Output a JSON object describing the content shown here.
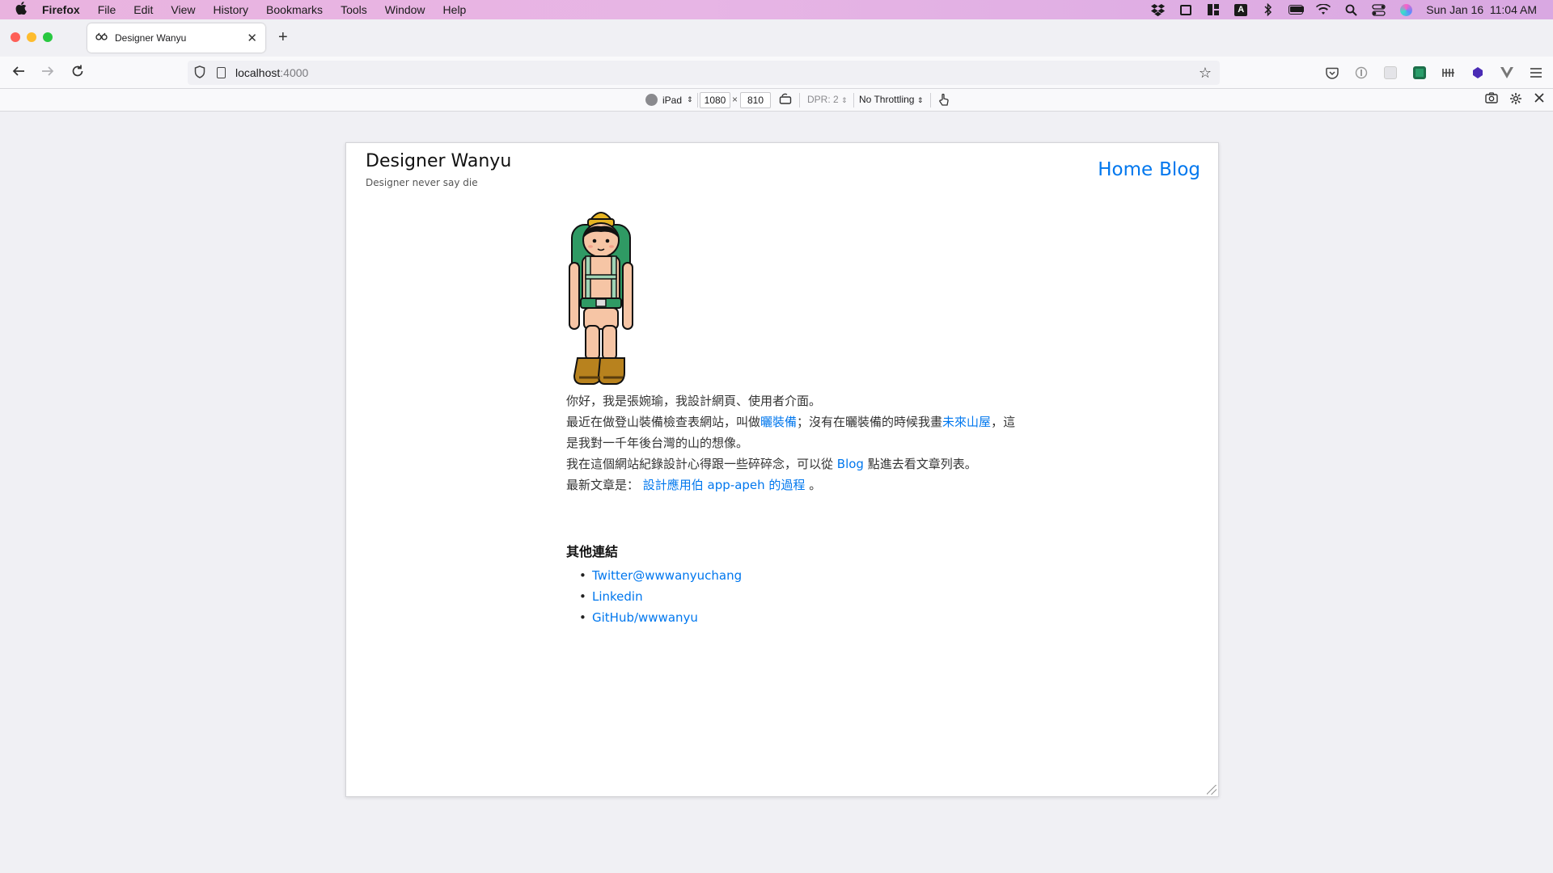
{
  "menubar": {
    "app_name": "Firefox",
    "items": [
      "File",
      "Edit",
      "View",
      "History",
      "Bookmarks",
      "Tools",
      "Window",
      "Help"
    ],
    "clock": "Sun Jan 16  11:04 AM"
  },
  "browser": {
    "tab_title": "Designer Wanyu",
    "url_host": "localhost",
    "url_port": ":4000"
  },
  "rdm": {
    "device": "iPad",
    "width": "1080",
    "height": "810",
    "times": "×",
    "dpr": "DPR: 2",
    "throttling": "No Throttling"
  },
  "site": {
    "title": "Designer Wanyu",
    "tagline": "Designer never say die",
    "nav": [
      "Home",
      "Blog"
    ],
    "intro": {
      "line1": "你好，我是張婉瑜，我設計網頁、使用者介面。",
      "line2_pre": "最近在做登山裝備檢查表網站，叫做",
      "line2_link1": "曬裝備",
      "line2_mid": "；沒有在曬裝備的時候我畫",
      "line2_link2": "未來山屋",
      "line2_post": "，這是我對一千年後台灣的山的想像。",
      "line3_pre": "我在這個網站紀錄設計心得跟一些碎碎念，可以從 ",
      "line3_link": "Blog",
      "line3_post": " 點進去看文章列表。",
      "line4_pre": "最新文章是： ",
      "line4_link": "設計應用伯 app-apeh 的過程",
      "line4_post": " 。"
    },
    "other_links_heading": "其他連結",
    "other_links": [
      "Twitter@wwwanyuchang",
      "Linkedin",
      "GitHub/wwwanyu"
    ]
  },
  "colors": {
    "link": "#0077ee",
    "menubar": "#e7b5e5"
  }
}
